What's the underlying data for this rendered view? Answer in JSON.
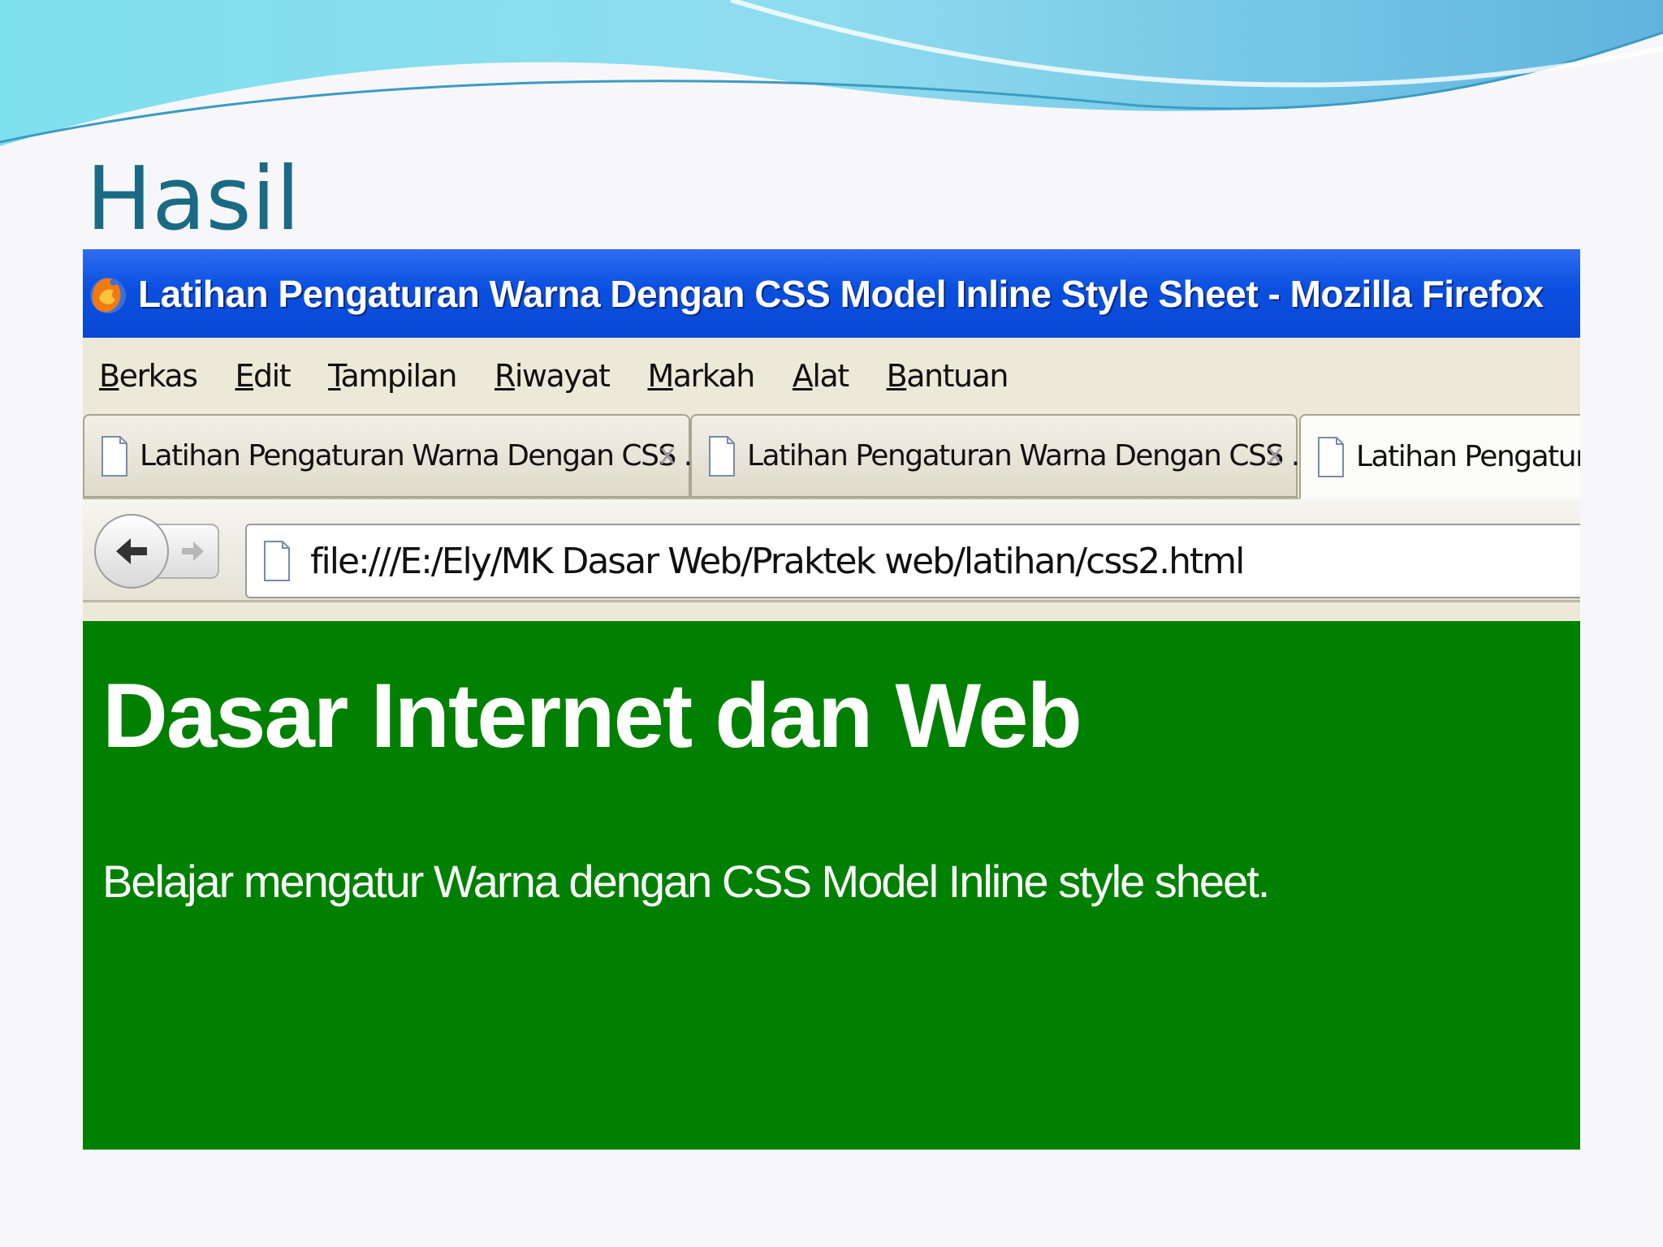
{
  "slide": {
    "title": "Hasil"
  },
  "window": {
    "title": "Latihan Pengaturan Warna Dengan CSS Model Inline Style Sheet - Mozilla Firefox"
  },
  "menu": [
    "Berkas",
    "Edit",
    "Tampilan",
    "Riwayat",
    "Markah",
    "Alat",
    "Bantuan"
  ],
  "tabs": [
    {
      "label": "Latihan Pengaturan Warna Dengan CSS ...",
      "close": "x",
      "active": false
    },
    {
      "label": "Latihan Pengaturan Warna Dengan CSS ...",
      "close": "x",
      "active": false
    },
    {
      "label": "Latihan Pengaturan",
      "active": true
    }
  ],
  "navigation": {
    "url": "file:///E:/Ely/MK Dasar Web/Praktek web/latihan/css2.html"
  },
  "page": {
    "heading": "Dasar Internet dan Web",
    "paragraph": "Belajar mengatur Warna dengan CSS Model Inline style sheet.",
    "background_color": "#008000",
    "text_color": "#ffffff"
  },
  "colors": {
    "titlebar": "#0a4fe0",
    "slide_title": "#1a6a85",
    "chrome": "#ece9d8"
  }
}
